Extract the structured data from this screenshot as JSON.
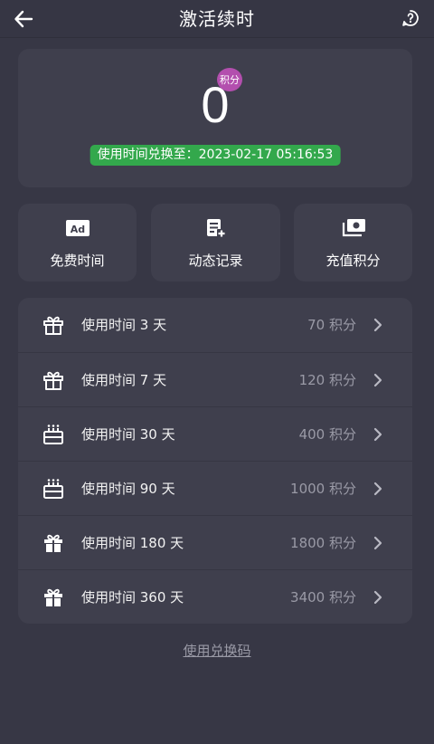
{
  "header": {
    "title": "激活续时",
    "back_icon": "arrow-left-icon",
    "help_icon": "help-circle-icon"
  },
  "points": {
    "value": "0",
    "badge_label": "积分",
    "expiry_text": "使用时间兑换至：2023-02-17 05:16:53"
  },
  "actions": [
    {
      "label": "免费时间",
      "icon": "ad-icon"
    },
    {
      "label": "动态记录",
      "icon": "record-add-icon"
    },
    {
      "label": "充值积分",
      "icon": "money-icon"
    }
  ],
  "plans": [
    {
      "name": "使用时间 3 天",
      "cost": "70 积分",
      "icon": "gift-icon"
    },
    {
      "name": "使用时间 7 天",
      "cost": "120 积分",
      "icon": "gift-icon"
    },
    {
      "name": "使用时间 30 天",
      "cost": "400 积分",
      "icon": "cake-icon"
    },
    {
      "name": "使用时间 90 天",
      "cost": "1000 积分",
      "icon": "cake-icon"
    },
    {
      "name": "使用时间 180 天",
      "cost": "1800 积分",
      "icon": "gift-filled-icon"
    },
    {
      "name": "使用时间 360 天",
      "cost": "3400 积分",
      "icon": "gift-filled-icon"
    }
  ],
  "footer": {
    "redeem_link": "使用兑换码"
  },
  "colors": {
    "background": "#373745",
    "card": "#3f3f4d",
    "badge": "#b34fae",
    "expiry_bg": "#33a84c",
    "muted_text": "#9a9aa6"
  }
}
